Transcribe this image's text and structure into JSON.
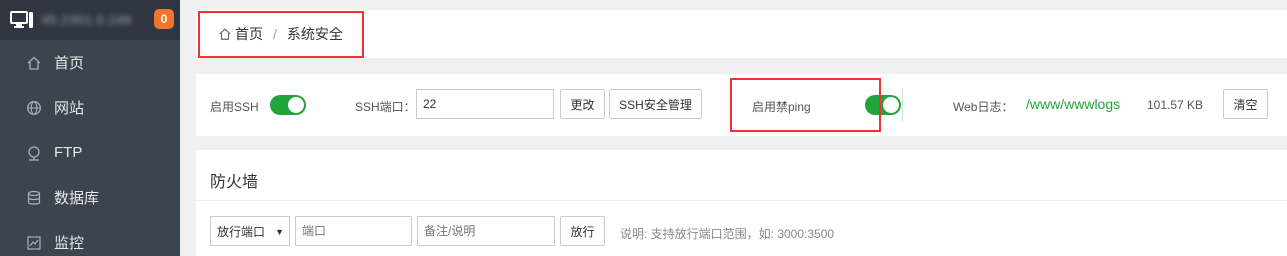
{
  "sidebar": {
    "server_name": "45.2301.0.146",
    "badge_count": "0",
    "items": [
      {
        "label": "首页",
        "icon": "home-icon"
      },
      {
        "label": "网站",
        "icon": "globe-icon"
      },
      {
        "label": "FTP",
        "icon": "ftp-icon"
      },
      {
        "label": "数据库",
        "icon": "database-icon"
      },
      {
        "label": "监控",
        "icon": "monitor-chart-icon"
      }
    ]
  },
  "breadcrumb": {
    "home": "首页",
    "separator": "/",
    "current": "系统安全"
  },
  "settings": {
    "ssh_label": "启用SSH",
    "ssh_enabled": true,
    "ssh_port_label": "SSH端口：",
    "ssh_port_value": "22",
    "change_button": "更改",
    "ssh_manage_button": "SSH安全管理",
    "ping_label": "启用禁ping",
    "ping_enabled": true,
    "web_log_label": "Web日志：",
    "web_log_path": "/www/wwwlogs",
    "web_log_size": "101.57 KB",
    "clear_button": "清空"
  },
  "firewall": {
    "title": "防火墙",
    "select_value": "放行端口",
    "port_placeholder": "端口",
    "note_placeholder": "备注/说明",
    "allow_button": "放行",
    "hint": "说明: 支持放行端口范围，如: 3000:3500"
  },
  "colors": {
    "sidebar_bg": "#3c444d",
    "accent_green": "#20a53a",
    "badge_orange": "#f0752d",
    "highlight_red": "#e33333"
  }
}
